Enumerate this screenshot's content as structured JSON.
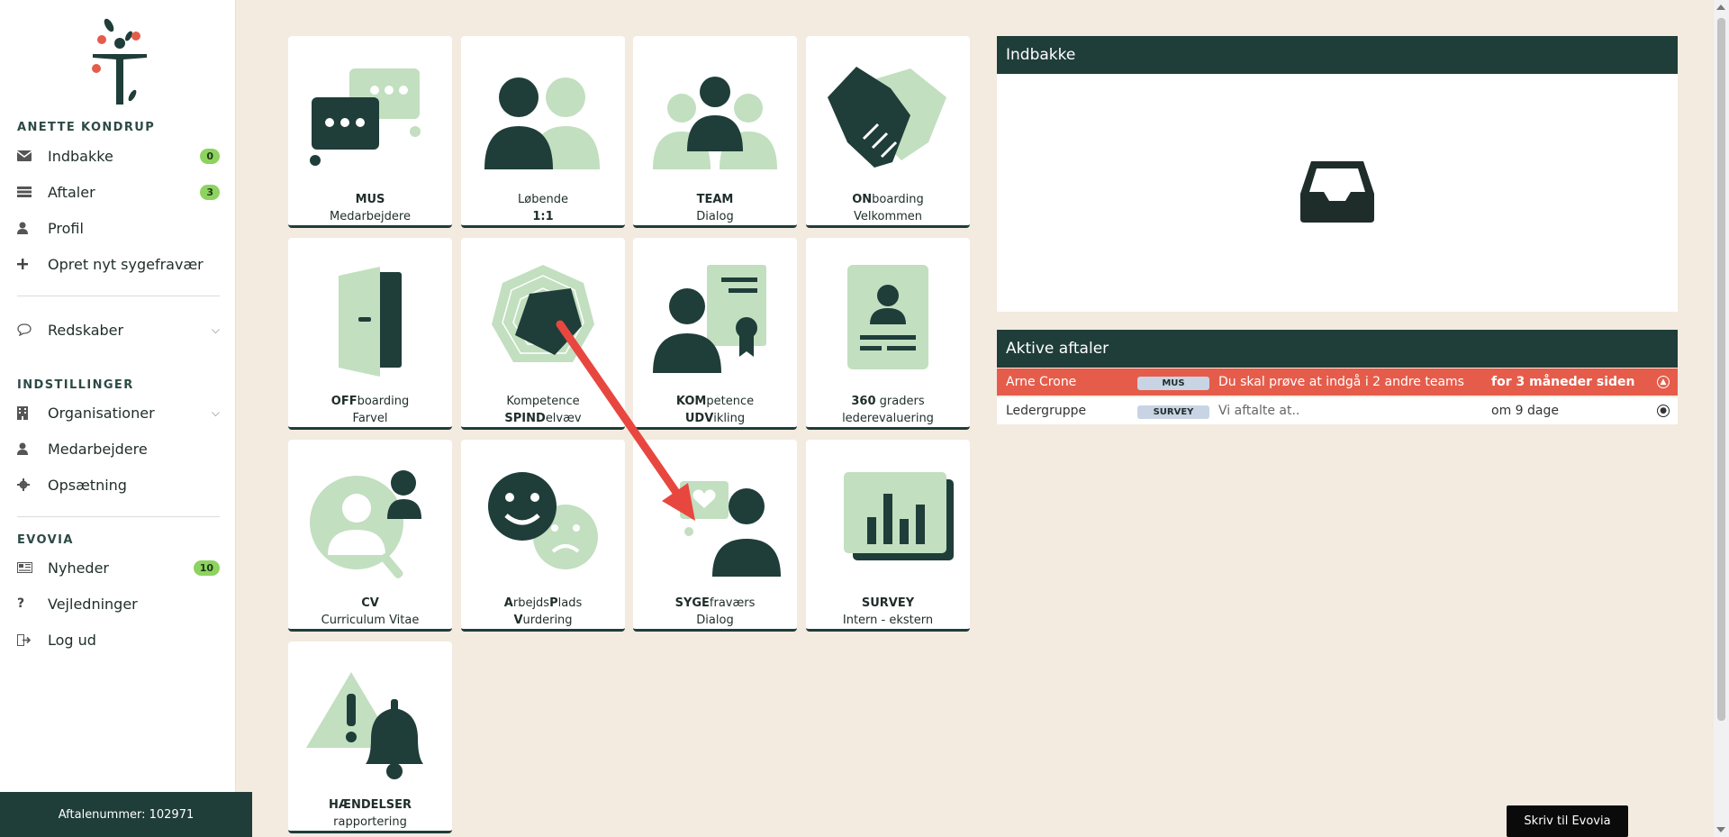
{
  "sidebar": {
    "user_name": "ANETTE KONDRUP",
    "items": [
      {
        "label": "Indbakke",
        "badge": "0",
        "icon": "envelope-icon"
      },
      {
        "label": "Aftaler",
        "badge": "3",
        "icon": "list-icon"
      },
      {
        "label": "Profil",
        "icon": "user-icon"
      },
      {
        "label": "Opret nyt sygefravær",
        "icon": "plus-icon"
      }
    ],
    "tools": {
      "label": "Redskaber",
      "icon": "chat-bubble-icon"
    },
    "settings_header": "INDSTILLINGER",
    "settings_items": [
      {
        "label": "Organisationer",
        "icon": "building-icon"
      },
      {
        "label": "Medarbejdere",
        "icon": "user-icon"
      },
      {
        "label": "Opsætning",
        "icon": "gear-icon"
      }
    ],
    "evovia_header": "EVOVIA",
    "evovia_items": [
      {
        "label": "Nyheder",
        "badge": "10",
        "icon": "newspaper-icon"
      },
      {
        "label": "Vejledninger",
        "icon": "question-icon"
      },
      {
        "label": "Log ud",
        "icon": "logout-icon"
      }
    ],
    "footer": "Aftalenummer: 102971"
  },
  "tiles": [
    {
      "l1_bold": "MUS",
      "l1_rest": "",
      "l2_bold": "",
      "l2_rest": "Medarbejdere",
      "icon": "chat-bubbles-icon"
    },
    {
      "l1_bold": "",
      "l1_rest": "Løbende",
      "l2_bold": "1:1",
      "l2_rest": "",
      "icon": "two-people-icon"
    },
    {
      "l1_bold": "TEAM",
      "l1_rest": "",
      "l2_bold": "",
      "l2_rest": "Dialog",
      "icon": "team-icon"
    },
    {
      "l1_bold": "ON",
      "l1_rest": "boarding",
      "l2_bold": "",
      "l2_rest": "Velkommen",
      "icon": "handshake-icon"
    },
    {
      "l1_bold": "OFF",
      "l1_rest": "boarding",
      "l2_bold": "",
      "l2_rest": "Farvel",
      "icon": "door-icon"
    },
    {
      "l1_bold": "",
      "l1_rest": "Kompetence",
      "l2_bold": "SPIND",
      "l2_rest": "elvæv",
      "icon": "spider-web-icon"
    },
    {
      "l1_bold": "KOM",
      "l1_rest": "petence",
      "l2_bold": "UDV",
      "l2_rest": "ikling",
      "icon": "certificate-icon"
    },
    {
      "l1_bold": "360",
      "l1_rest": " graders",
      "l2_bold": "",
      "l2_rest": "lederevaluering",
      "icon": "id-card-icon"
    },
    {
      "l1_bold": "CV",
      "l1_rest": "",
      "l2_bold": "",
      "l2_rest": "Curriculum Vitae",
      "icon": "person-search-icon"
    },
    {
      "l1_bold": "A",
      "l1_rest": "rbejds",
      "l1_bold2": "P",
      "l1_rest2": "lads",
      "l2_bold": "V",
      "l2_rest": "urdering",
      "icon": "happy-sad-icon"
    },
    {
      "l1_bold": "SYGE",
      "l1_rest": "fraværs",
      "l2_bold": "",
      "l2_rest": "Dialog",
      "icon": "sick-dialog-icon"
    },
    {
      "l1_bold": "SURVEY",
      "l1_rest": "",
      "l2_bold": "",
      "l2_rest": "Intern - ekstern",
      "icon": "bar-chart-icon"
    },
    {
      "l1_bold": "HÆNDELSER",
      "l1_rest": "",
      "l2_bold": "",
      "l2_rest": "rapportering",
      "icon": "warning-bell-icon"
    }
  ],
  "inbox": {
    "title": "Indbakke",
    "icon": "inbox-tray-icon"
  },
  "appointments": {
    "title": "Aktive aftaler",
    "rows": [
      {
        "name": "Arne Crone",
        "tag": "MUS",
        "message": "Du skal prøve at indgå i 2 andre teams",
        "when": "for 3 måneder siden",
        "status": "overdue"
      },
      {
        "name": "Ledergruppe",
        "tag": "SURVEY",
        "message": "Vi aftalte at..",
        "when": "om 9 dage",
        "status": "upcoming"
      }
    ]
  },
  "write_button": "Skriv til Evovia",
  "colors": {
    "dark_green": "#1f3d39",
    "light_green": "#c2dfc0",
    "alert_red": "#e55c4b",
    "background": "#f3eae0"
  }
}
